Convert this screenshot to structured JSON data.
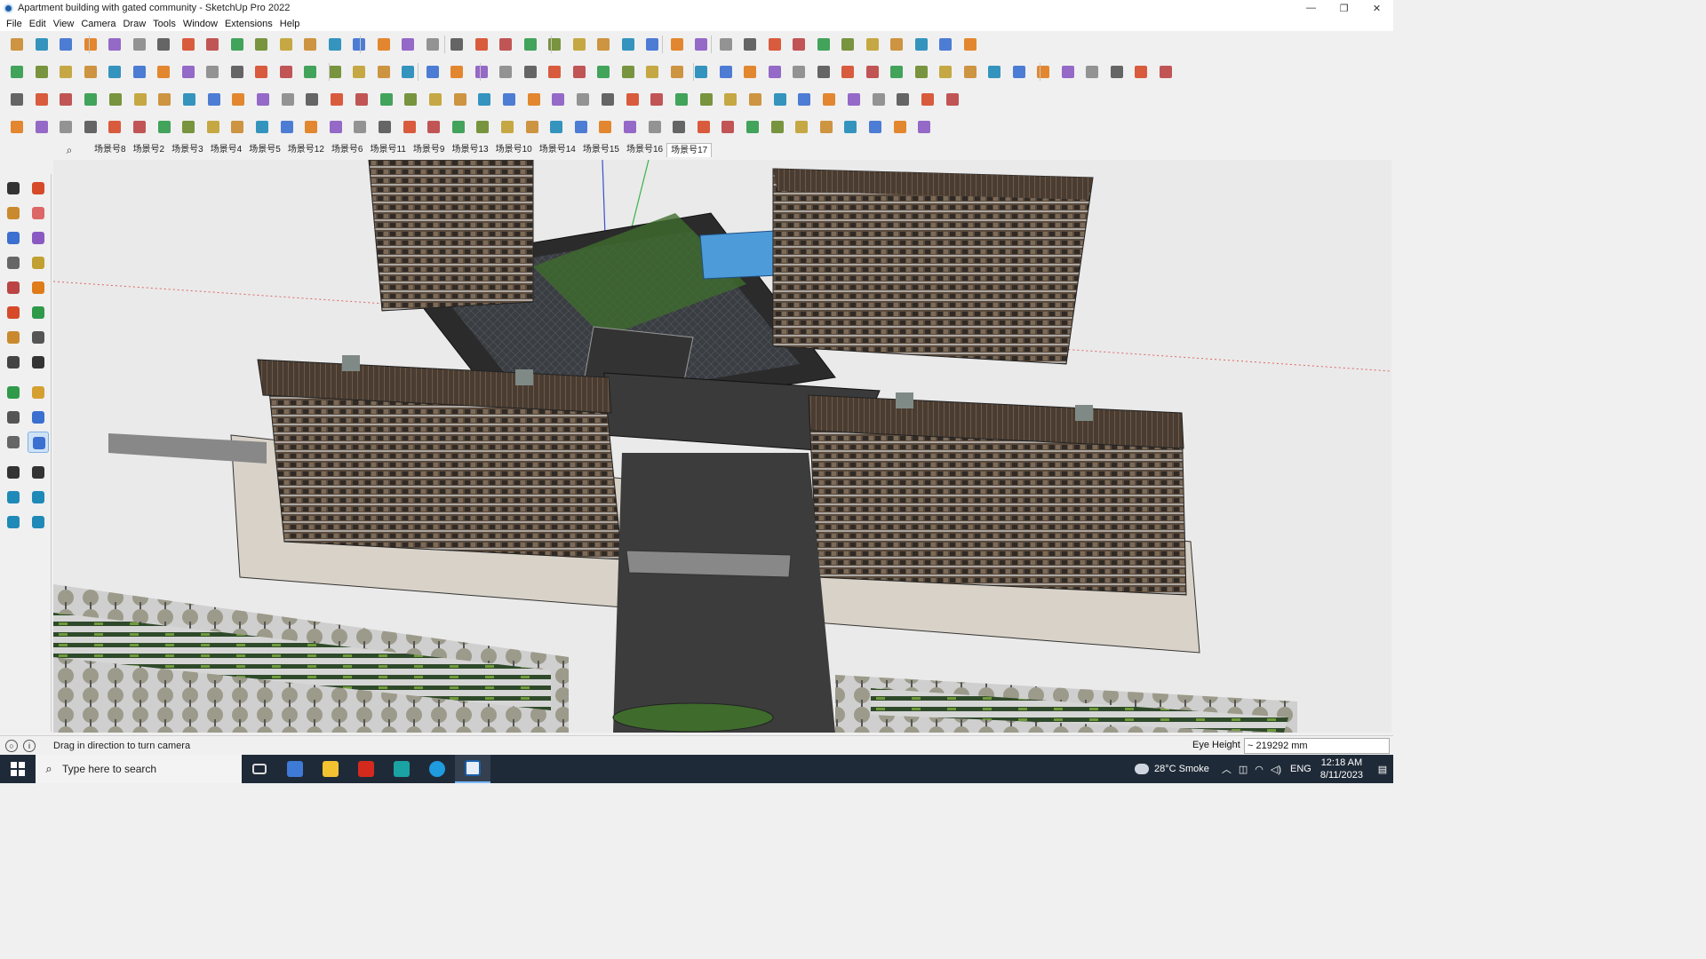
{
  "window": {
    "title": "Apartment building with gated community - SketchUp Pro 2022",
    "controls": {
      "minimize": "—",
      "restore": "❐",
      "close": "✕"
    }
  },
  "menu": [
    "File",
    "Edit",
    "View",
    "Camera",
    "Draw",
    "Tools",
    "Window",
    "Extensions",
    "Help"
  ],
  "scenes": {
    "search_icon": "⌕",
    "tabs": [
      "场景号8",
      "场景号2",
      "场景号3",
      "场景号4",
      "场景号5",
      "场景号12",
      "场景号6",
      "场景号11",
      "场景号9",
      "场景号13",
      "场景号10",
      "场景号14",
      "场景号15",
      "场景号16",
      "场景号17"
    ],
    "active": "场景号17"
  },
  "status": {
    "message": "Drag in direction to turn camera",
    "measurements_label": "Eye Height",
    "measurements_value": "~ 219292 mm"
  },
  "taskbar": {
    "search_placeholder": "Type here to search",
    "weather": "28°C  Smoke",
    "language": "ENG",
    "time": "12:18 AM",
    "date": "8/11/2023"
  },
  "colors": {
    "accent_blue": "#1b5fa8",
    "building_brown": "#5a4a3c",
    "roof_dark": "#2e2e2e",
    "grass_green": "#4b7a35",
    "pool_blue": "#4d9bd9"
  }
}
